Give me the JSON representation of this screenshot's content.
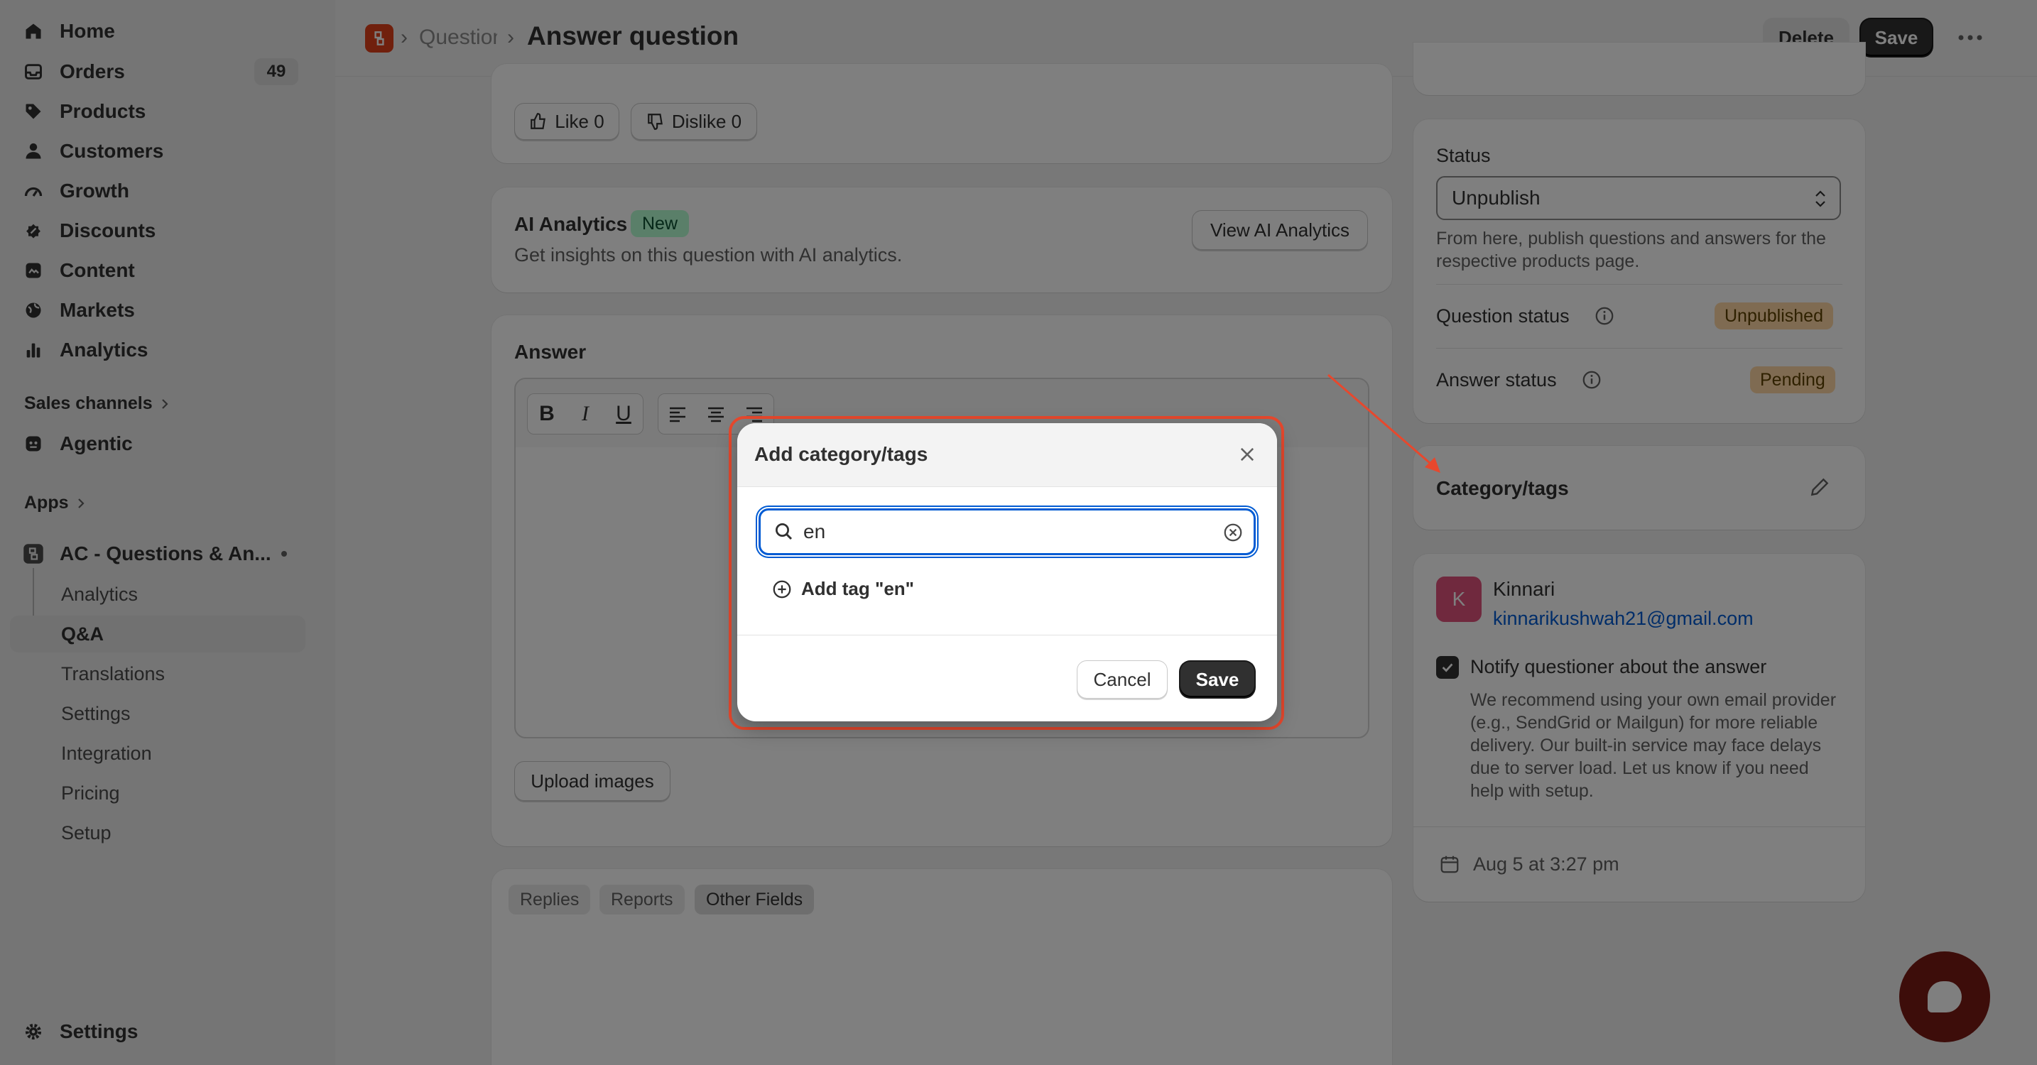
{
  "sidebar": {
    "nav": [
      {
        "label": "Home",
        "icon": "home-icon"
      },
      {
        "label": "Orders",
        "icon": "inbox-icon",
        "badge": "49"
      },
      {
        "label": "Products",
        "icon": "tag-icon"
      },
      {
        "label": "Customers",
        "icon": "person-icon"
      },
      {
        "label": "Growth",
        "icon": "gauge-icon"
      },
      {
        "label": "Discounts",
        "icon": "discount-icon"
      },
      {
        "label": "Content",
        "icon": "content-icon"
      },
      {
        "label": "Markets",
        "icon": "globe-icon"
      },
      {
        "label": "Analytics",
        "icon": "bar-chart-icon"
      }
    ],
    "sales_channels": "Sales channels",
    "agentic": "Agentic",
    "apps": "Apps",
    "app_name": "AC - Questions & An...",
    "app_subitems": [
      "Analytics",
      "Q&A",
      "Translations",
      "Settings",
      "Integration",
      "Pricing",
      "Setup"
    ],
    "settings": "Settings"
  },
  "header": {
    "breadcrumb": "Questions",
    "title": "Answer question",
    "delete_label": "Delete",
    "save_label": "Save"
  },
  "reactions": {
    "like": "Like 0",
    "dislike": "Dislike 0"
  },
  "ai_analytics": {
    "title": "AI Analytics",
    "badge": "New",
    "description": "Get insights on this question with AI analytics.",
    "button": "View AI Analytics"
  },
  "answer": {
    "title": "Answer",
    "upload_label": "Upload images"
  },
  "tabs": [
    "Replies",
    "Reports",
    "Other Fields"
  ],
  "status_card": {
    "label": "Status",
    "selected": "Unpublish",
    "help": "From here, publish questions and answers for the respective products page.",
    "question_status_label": "Question status",
    "question_status": "Unpublished",
    "answer_status_label": "Answer status",
    "answer_status": "Pending"
  },
  "category": {
    "title": "Category/tags"
  },
  "customer": {
    "initial": "K",
    "name": "Kinnari",
    "email": "kinnarikushwah21@gmail.com",
    "notify_label": "Notify questioner about the answer",
    "notify_help": "We recommend using your own email provider (e.g., SendGrid or Mailgun) for more reliable delivery. Our built-in service may face delays due to server load. Let us know if you need help with setup.",
    "date": "Aug 5 at 3:27 pm"
  },
  "modal": {
    "title": "Add category/tags",
    "search_value": "en",
    "add_tag_label": "Add tag \"en\"",
    "cancel_label": "Cancel",
    "save_label": "Save"
  },
  "colors": {
    "accent_red": "#e7482d",
    "focus_blue": "#005bd3",
    "link_blue": "#005bd3",
    "primary_dark": "#303030",
    "avatar_pink": "#e0537d"
  }
}
